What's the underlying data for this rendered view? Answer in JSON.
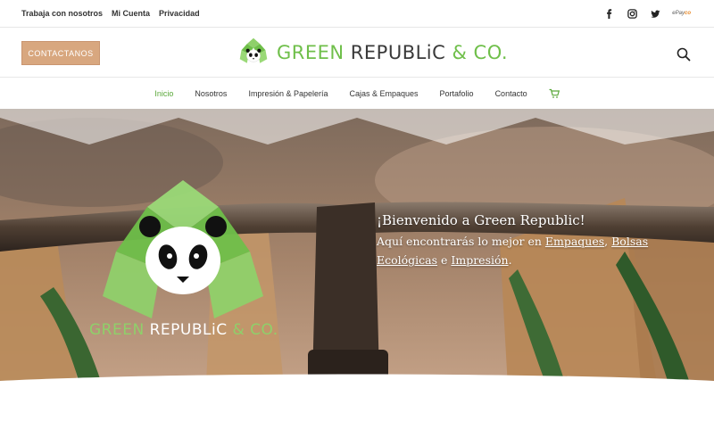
{
  "topbar": {
    "links": [
      "Trabaja con nosotros",
      "Mi Cuenta",
      "Privacidad"
    ],
    "social": [
      "facebook-icon",
      "instagram-icon",
      "twitter-icon"
    ],
    "epayco_prefix": "ePay",
    "epayco_suffix": "co"
  },
  "header": {
    "contact_label": "CONTACTANOS",
    "logo_green": "GREEN",
    "logo_dark": " REPUBLiC",
    "logo_amp": " & CO."
  },
  "nav": {
    "items": [
      "Inicio",
      "Nosotros",
      "Impresión & Papelería",
      "Cajas & Empaques",
      "Portafolio",
      "Contacto"
    ],
    "active": "Inicio"
  },
  "hero": {
    "title": "¡Bienvenido a Green Republic!",
    "line_prefix": "Aquí encontrarás lo mejor en ",
    "link1": "Empaques",
    "sep1": ", ",
    "link2": "Bolsas Ecológicas",
    "sep2": " e ",
    "link3": "Impresión",
    "end": ".",
    "brand_green": "GREEN",
    "brand_white": " REPUBLiC",
    "brand_amp": " & CO."
  },
  "colors": {
    "accent": "#6fbf4a",
    "button": "#d8a77f",
    "active_nav": "#5aa83a"
  }
}
